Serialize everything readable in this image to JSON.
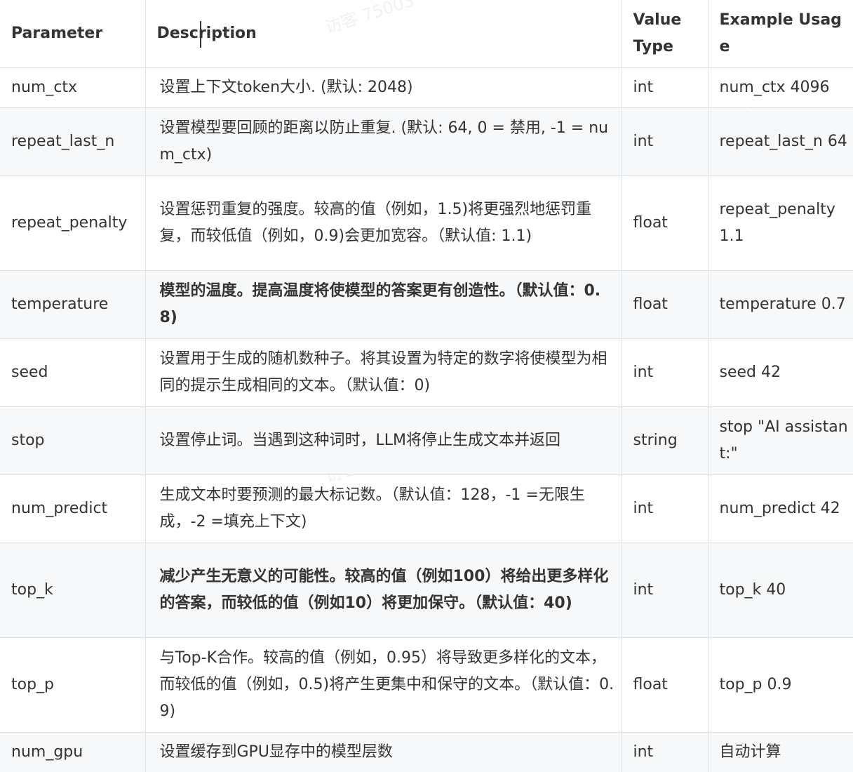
{
  "table": {
    "headers": {
      "parameter": "Parameter",
      "description": "Description",
      "value_type": "Value Type",
      "example": "Example Usage"
    },
    "rows": [
      {
        "parameter": "num_ctx",
        "description": "设置上下文token大小. (默认: 2048)",
        "value_type": "int",
        "example": "num_ctx 4096"
      },
      {
        "parameter": "repeat_last_n",
        "description": "设置模型要回顾的距离以防止重复. (默认: 64, 0 = 禁用, -1 = num_ctx)",
        "value_type": "int",
        "example": "repeat_last_n 64"
      },
      {
        "parameter": "repeat_penalty",
        "description": "设置惩罚重复的强度。较高的值（例如，1.5)将更强烈地惩罚重复，而较低值（例如，0.9)会更加宽容。（默认值: 1.1)",
        "value_type": "float",
        "example": "repeat_penalty 1.1"
      },
      {
        "parameter": "temperature",
        "description": "模型的温度。提高温度将使模型的答案更有创造性。（默认值：0.8)",
        "value_type": "float",
        "example": "temperature 0.7"
      },
      {
        "parameter": "seed",
        "description": "设置用于生成的随机数种子。将其设置为特定的数字将使模型为相同的提示生成相同的文本。（默认值：0)",
        "value_type": "int",
        "example": "seed 42"
      },
      {
        "parameter": "stop",
        "description": "设置停止词。当遇到这种词时，LLM将停止生成文本并返回",
        "value_type": "string",
        "example": "stop \"AI assistant:\""
      },
      {
        "parameter": "num_predict",
        "description": "生成文本时要预测的最大标记数。（默认值：128，-1 =无限生成，-2 =填充上下文)",
        "value_type": "int",
        "example": "num_predict 42"
      },
      {
        "parameter": "top_k",
        "description": "减少产生无意义的可能性。较高的值（例如100）将给出更多样化的答案，而较低的值（例如10）将更加保守。（默认值：40)",
        "value_type": "int",
        "example": "top_k 40"
      },
      {
        "parameter": "top_p",
        "description": "与Top-K合作。较高的值（例如，0.95）将导致更多样化的文本，而较低的值（例如，0.5)将产生更集中和保守的文本。（默认值：0.9)",
        "value_type": "float",
        "example": "top_p 0.9"
      },
      {
        "parameter": "num_gpu",
        "description": "设置缓存到GPU显存中的模型层数",
        "value_type": "int",
        "example": "自动计算"
      }
    ]
  },
  "watermark": "访客 75003"
}
